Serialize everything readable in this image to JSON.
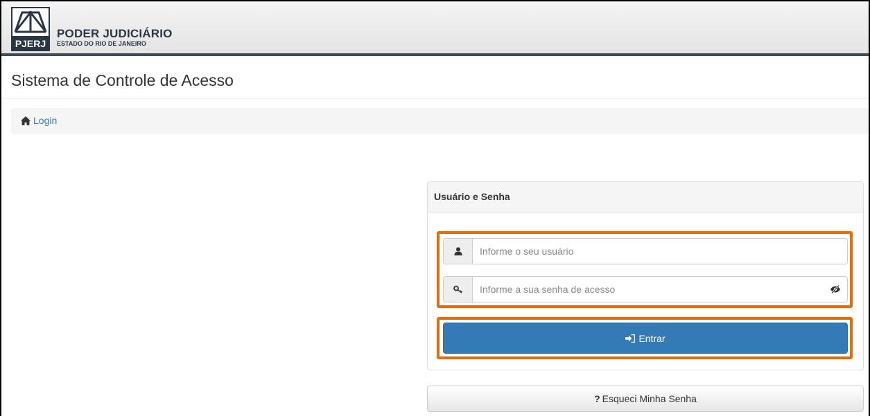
{
  "header": {
    "logo_text": "PJERJ",
    "org_name": "PODER JUDICIÁRIO",
    "org_sub": "ESTADO DO RIO DE JANEIRO"
  },
  "page": {
    "title": "Sistema de Controle de Acesso"
  },
  "breadcrumb": {
    "icon": "home-icon",
    "label": "Login"
  },
  "login_panel": {
    "heading": "Usuário e Senha",
    "username": {
      "icon": "user-icon",
      "value": "",
      "placeholder": "Informe o seu usuário"
    },
    "password": {
      "icon": "key-icon",
      "value": "",
      "placeholder": "Informe a sua senha de acesso",
      "toggle_icon": "eye-slash-icon"
    },
    "submit": {
      "icon": "sign-in-icon",
      "label": "Entrar"
    }
  },
  "forgot": {
    "icon": "question-icon",
    "mark": "?",
    "label": "Esqueci Minha Senha"
  },
  "colors": {
    "primary": "#337ab7",
    "highlight": "#e46c0a",
    "header_rule": "#3e4b5a"
  }
}
